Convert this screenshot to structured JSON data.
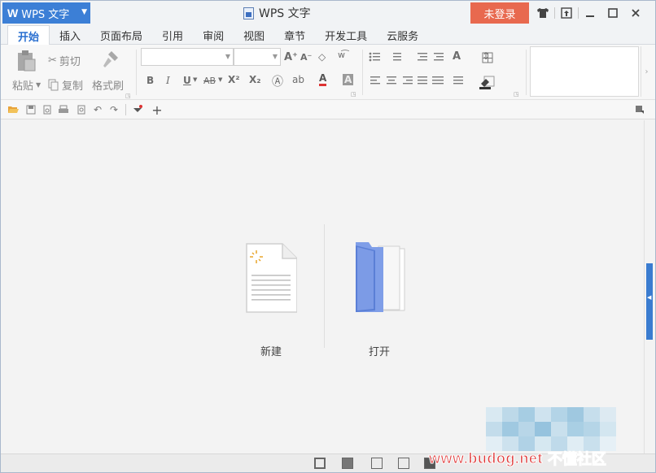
{
  "titlebar": {
    "app_label": "WPS 文字",
    "document_title": "WPS 文字",
    "login_label": "未登录"
  },
  "tabs": [
    {
      "label": "开始",
      "active": true
    },
    {
      "label": "插入",
      "active": false
    },
    {
      "label": "页面布局",
      "active": false
    },
    {
      "label": "引用",
      "active": false
    },
    {
      "label": "审阅",
      "active": false
    },
    {
      "label": "视图",
      "active": false
    },
    {
      "label": "章节",
      "active": false
    },
    {
      "label": "开发工具",
      "active": false
    },
    {
      "label": "云服务",
      "active": false
    }
  ],
  "ribbon": {
    "paste_label": "粘贴",
    "cut_label": "剪切",
    "copy_label": "复制",
    "format_painter_label": "格式刷",
    "font_name_value": "",
    "font_size_value": "",
    "glyphs": {
      "bold": "B",
      "italic": "I",
      "underline": "U",
      "strikethrough": "AB",
      "superscript": "X²",
      "subscript": "X₂",
      "grow_font": "A⁺",
      "shrink_font": "A⁻",
      "font_color": "A",
      "change_case": "A"
    }
  },
  "main": {
    "new_label": "新建",
    "open_label": "打开"
  },
  "watermark": {
    "url": "www.budog.net",
    "site_name": "不懂社区"
  },
  "colors": {
    "accent": "#3c7fd6",
    "login": "#e8694f",
    "active_tab": "#2a6fd0",
    "watermark": "#d8262c"
  }
}
